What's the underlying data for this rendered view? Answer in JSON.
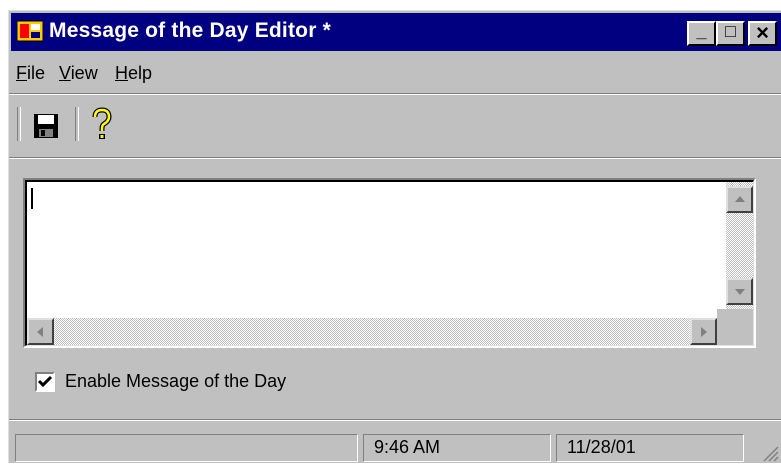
{
  "window": {
    "title": "Message of the Day Editor *",
    "minimize_glyph": "_",
    "maximize_glyph": "□",
    "close_glyph": "×"
  },
  "menu": {
    "file": {
      "label_first": "F",
      "label_rest": "ile"
    },
    "view": {
      "label_first": "V",
      "label_rest": "iew"
    },
    "help": {
      "label_first": "H",
      "label_rest": "elp"
    }
  },
  "toolbar": {
    "save_icon": "floppy-disk-icon",
    "help_icon": "question-mark-icon",
    "help_glyph": "?"
  },
  "editor": {
    "text": ""
  },
  "options": {
    "enable_checked": true,
    "enable_label": "Enable Message of the Day"
  },
  "status": {
    "panel1": "",
    "time": "9:46 AM",
    "date": "11/28/01"
  },
  "colors": {
    "titlebar": "#000080",
    "face": "#c0c0c0"
  }
}
